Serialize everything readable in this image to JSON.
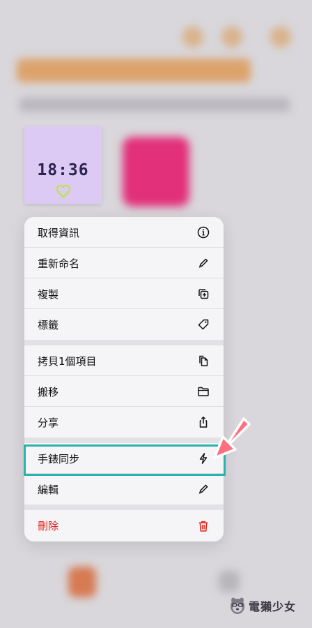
{
  "watch_face": {
    "time": "18:36"
  },
  "menu": {
    "items": [
      {
        "label": "取得資訊",
        "icon": "info-icon"
      },
      {
        "label": "重新命名",
        "icon": "pencil-icon"
      },
      {
        "label": "複製",
        "icon": "duplicate-icon"
      },
      {
        "label": "標籤",
        "icon": "tag-icon"
      },
      {
        "label": "拷貝1個項目",
        "icon": "copy-docs-icon"
      },
      {
        "label": "搬移",
        "icon": "folder-icon"
      },
      {
        "label": "分享",
        "icon": "share-icon"
      },
      {
        "label": "手錶同步",
        "icon": "bolt-icon"
      },
      {
        "label": "編輯",
        "icon": "pencil-icon"
      },
      {
        "label": "刪除",
        "icon": "trash-icon"
      }
    ]
  },
  "colors": {
    "accent_highlight": "#29b3ad",
    "arrow": "#ff6f7d",
    "destructive": "#e0241f",
    "face_background": "#dccaf4",
    "heart": "#b8e82a"
  },
  "watermark": {
    "text": "電獺少女"
  }
}
